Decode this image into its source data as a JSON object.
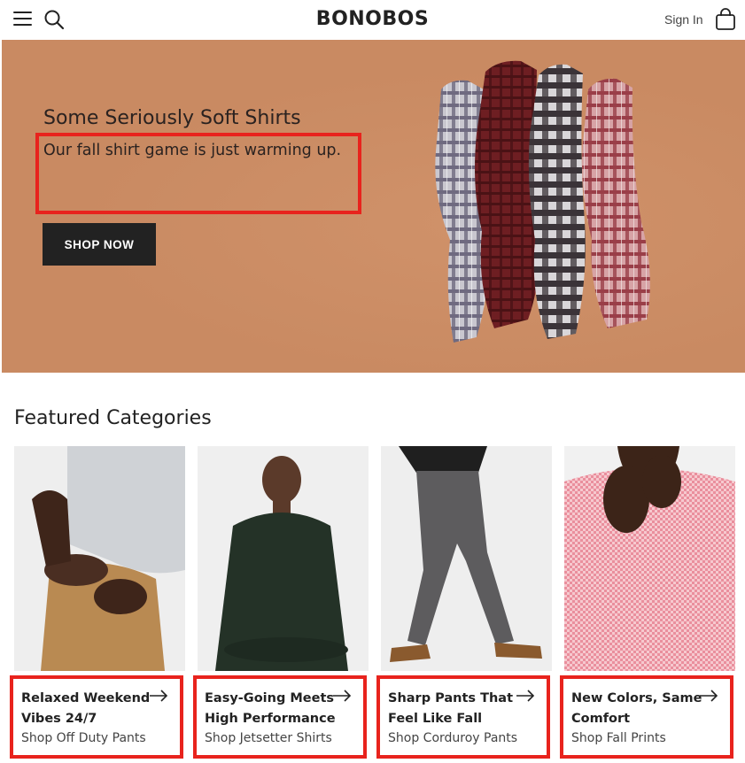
{
  "header": {
    "logo": "BONOBOS",
    "sign_in": "Sign In",
    "icons": [
      "menu-icon",
      "search-icon",
      "shopping-bag-icon"
    ]
  },
  "hero": {
    "title": "Some Seriously Soft Shirts",
    "subtitle": "Our fall shirt game is just warming up.",
    "cta": "SHOP NOW",
    "colors": {
      "background": "#c98a62",
      "highlight": "#e8231d",
      "button": "#222222"
    }
  },
  "featured": {
    "title": "Featured Categories",
    "cards": [
      {
        "title": "Relaxed Weekend Vibes 24/7",
        "link": "Shop Off Duty Pants"
      },
      {
        "title": "Easy-Going Meets High Performance",
        "link": "Shop Jetsetter Shirts"
      },
      {
        "title": "Sharp Pants That Feel Like Fall",
        "link": "Shop Corduroy Pants"
      },
      {
        "title": "New Colors, Same Comfort",
        "link": "Shop Fall Prints"
      }
    ]
  }
}
